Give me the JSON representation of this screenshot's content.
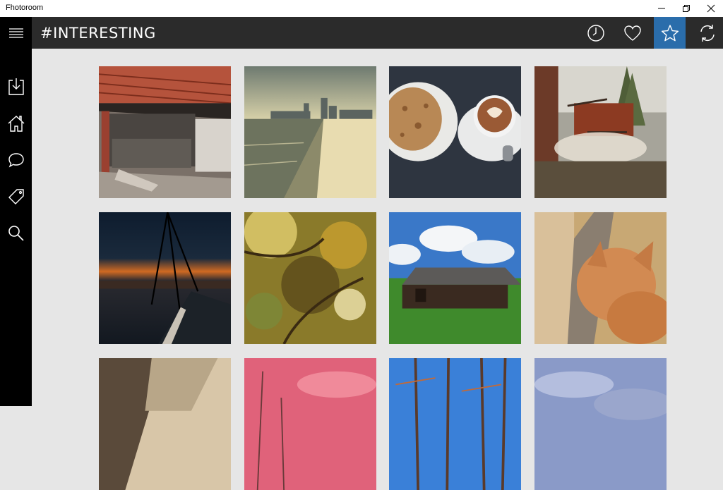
{
  "window": {
    "title": "Fhotoroom",
    "controls": [
      "minimize-icon",
      "restore-icon",
      "close-icon"
    ]
  },
  "header": {
    "title": "#INTERESTING",
    "buttons": [
      {
        "name": "recent",
        "icon": "clock-icon",
        "active": false
      },
      {
        "name": "favorites",
        "icon": "heart-icon",
        "active": false
      },
      {
        "name": "starred",
        "icon": "star-icon",
        "active": true
      },
      {
        "name": "refresh",
        "icon": "refresh-icon",
        "active": false
      }
    ],
    "accent_color": "#2a6dab",
    "background_color": "#2b2b2b"
  },
  "sidebar": {
    "items": [
      {
        "name": "menu",
        "icon": "hamburger-menu-icon"
      },
      {
        "name": "download",
        "icon": "download-icon"
      },
      {
        "name": "home",
        "icon": "home-icon"
      },
      {
        "name": "comments",
        "icon": "chat-bubble-icon"
      },
      {
        "name": "tags",
        "icon": "tag-icon"
      },
      {
        "name": "search",
        "icon": "search-icon"
      }
    ]
  },
  "photos": [
    {
      "subject": "abandoned-shed-red-tile-roof"
    },
    {
      "subject": "beach-city-skyline"
    },
    {
      "subject": "cookie-and-latte-art-coffee"
    },
    {
      "subject": "steam-and-machinery-with-trees"
    },
    {
      "subject": "sunset-sailboat-mast-harbor"
    },
    {
      "subject": "autumn-leaves-bokeh"
    },
    {
      "subject": "wooden-barn-green-field-blue-sky"
    },
    {
      "subject": "orange-cat-on-windowsill"
    },
    {
      "subject": "abstract-architecture-beige"
    },
    {
      "subject": "pink-sunset-clouds-grass"
    },
    {
      "subject": "burnt-trees-blue-sky"
    },
    {
      "subject": "blue-clouds-sky"
    }
  ]
}
